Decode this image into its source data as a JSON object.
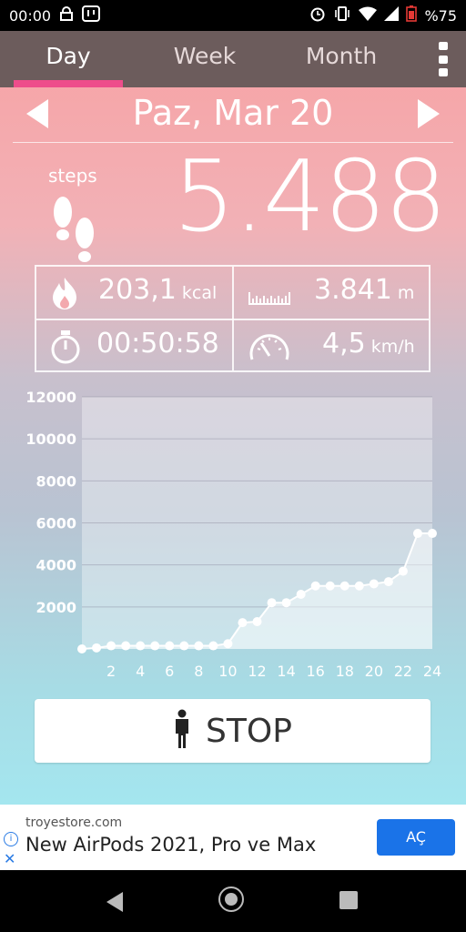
{
  "status_bar": {
    "time": "00:00",
    "battery": "%75"
  },
  "tabs": [
    {
      "label": "Day",
      "active": true
    },
    {
      "label": "Week",
      "active": false
    },
    {
      "label": "Month",
      "active": false
    }
  ],
  "date_nav": {
    "date": "Paz, Mar 20"
  },
  "steps": {
    "label": "steps",
    "value": "5.488"
  },
  "stats": {
    "calories": {
      "value": "203,1",
      "unit": "kcal"
    },
    "distance": {
      "value": "3.841",
      "unit": "m"
    },
    "duration": {
      "value": "00:50:58"
    },
    "speed": {
      "value": "4,5",
      "unit": "km/h"
    }
  },
  "chart_data": {
    "type": "line",
    "x": [
      0,
      1,
      2,
      3,
      4,
      5,
      6,
      7,
      8,
      9,
      10,
      11,
      12,
      13,
      14,
      15,
      16,
      17,
      18,
      19,
      20,
      21,
      22,
      23,
      24
    ],
    "values": [
      0,
      50,
      150,
      150,
      150,
      150,
      150,
      150,
      150,
      150,
      250,
      1250,
      1300,
      2200,
      2200,
      2600,
      3000,
      3000,
      3000,
      3000,
      3100,
      3200,
      3700,
      5500,
      5500
    ],
    "yticks": [
      "12000",
      "10000",
      "8000",
      "6000",
      "4000",
      "2000"
    ],
    "xticks": [
      "2",
      "4",
      "6",
      "8",
      "10",
      "12",
      "14",
      "16",
      "18",
      "20",
      "22",
      "24"
    ],
    "ylim": [
      0,
      12000
    ],
    "xlim": [
      0,
      24
    ],
    "grid": true
  },
  "action": {
    "stop_label": "STOP"
  },
  "ad": {
    "domain": "troyestore.com",
    "title": "New AirPods 2021, Pro ve Max",
    "button": "AÇ"
  }
}
